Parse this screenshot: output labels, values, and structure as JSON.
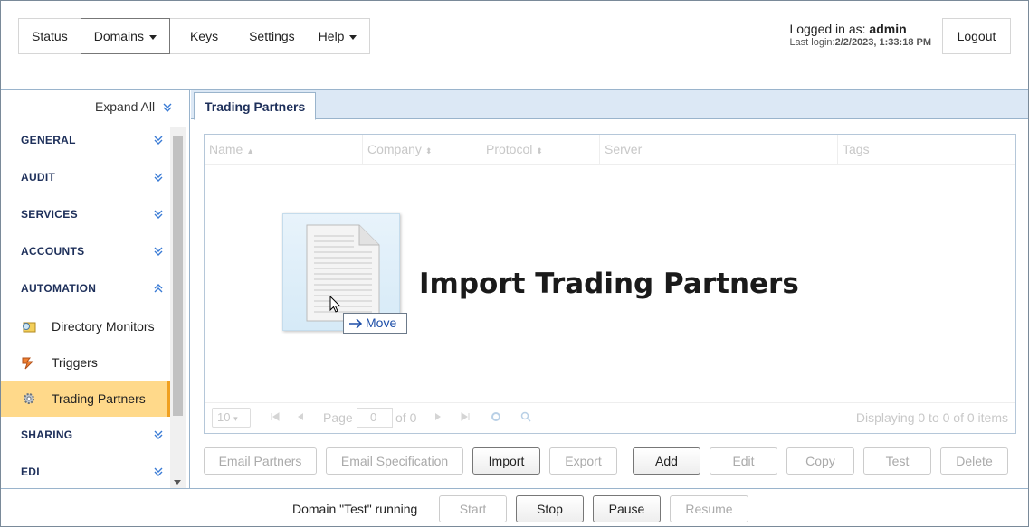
{
  "nav": {
    "items": [
      {
        "label": "Status",
        "dropdown": false,
        "active": false
      },
      {
        "label": "Domains",
        "dropdown": true,
        "active": true
      },
      {
        "label": "Keys",
        "dropdown": false,
        "active": false
      },
      {
        "label": "Settings",
        "dropdown": false,
        "active": false
      },
      {
        "label": "Help",
        "dropdown": true,
        "active": false
      }
    ]
  },
  "user": {
    "logged_in_prefix": "Logged in as:",
    "username": "admin",
    "last_login_prefix": "Last login:",
    "last_login_value": "2/2/2023, 1:33:18 PM",
    "logout_label": "Logout"
  },
  "sidebar": {
    "expand_all_label": "Expand All",
    "sections": [
      {
        "label": "GENERAL",
        "expanded": false
      },
      {
        "label": "AUDIT",
        "expanded": false
      },
      {
        "label": "SERVICES",
        "expanded": false
      },
      {
        "label": "ACCOUNTS",
        "expanded": false
      },
      {
        "label": "AUTOMATION",
        "expanded": true
      },
      {
        "label": "SHARING",
        "expanded": false
      },
      {
        "label": "EDI",
        "expanded": false
      }
    ],
    "automation_items": [
      {
        "label": "Directory Monitors",
        "icon": "folder-monitor-icon",
        "active": false
      },
      {
        "label": "Triggers",
        "icon": "trigger-icon",
        "active": false
      },
      {
        "label": "Trading Partners",
        "icon": "gear-icon",
        "active": true
      }
    ]
  },
  "main": {
    "tab_label": "Trading Partners",
    "grid": {
      "columns": [
        "Name",
        "Company",
        "Protocol",
        "Server",
        "Tags"
      ],
      "page_size": "10",
      "page_label": "Page",
      "page_value": "0",
      "of_label": "of 0",
      "displaying": "Displaying 0 to 0 of 0 items"
    },
    "drag": {
      "title": "Import Trading Partners",
      "tooltip": "Move"
    },
    "buttons": [
      {
        "label": "Email Partners",
        "enabled": false
      },
      {
        "label": "Email Specification",
        "enabled": false
      },
      {
        "label": "Import",
        "enabled": true
      },
      {
        "label": "Export",
        "enabled": false
      },
      {
        "label": "Add",
        "enabled": true
      },
      {
        "label": "Edit",
        "enabled": false
      },
      {
        "label": "Copy",
        "enabled": false
      },
      {
        "label": "Test",
        "enabled": false
      },
      {
        "label": "Delete",
        "enabled": false
      }
    ]
  },
  "statusbar": {
    "text": "Domain \"Test\" running",
    "buttons": [
      {
        "label": "Start",
        "enabled": false
      },
      {
        "label": "Stop",
        "enabled": true
      },
      {
        "label": "Pause",
        "enabled": true
      },
      {
        "label": "Resume",
        "enabled": false
      }
    ]
  },
  "colors": {
    "accent_border": "#9ab4cc",
    "tabstrip_bg": "#dce8f5",
    "active_item_bg": "#ffd98a",
    "section_title": "#1d2f5a",
    "tooltip_text": "#1e4fa8"
  }
}
